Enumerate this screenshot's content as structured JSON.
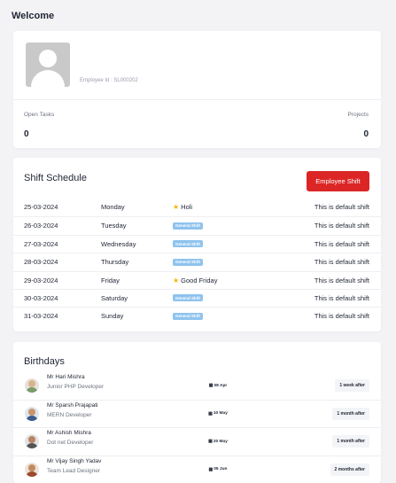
{
  "page": {
    "welcome": "Welcome"
  },
  "profile": {
    "employee_id": "Employee Id : SL000202",
    "open_tasks_label": "Open Tasks",
    "open_tasks_value": "0",
    "projects_label": "Projects",
    "projects_value": "0"
  },
  "shift": {
    "title": "Shift Schedule",
    "button": "Employee Shift",
    "rows": [
      {
        "date": "25-03-2024",
        "day": "Monday",
        "tag": "Holi",
        "tag_type": "holiday",
        "desc": "This is default shift"
      },
      {
        "date": "26-03-2024",
        "day": "Tuesday",
        "tag": "General Shift",
        "tag_type": "badge",
        "desc": "This is default shift"
      },
      {
        "date": "27-03-2024",
        "day": "Wednesday",
        "tag": "General Shift",
        "tag_type": "badge",
        "desc": "This is default shift"
      },
      {
        "date": "28-03-2024",
        "day": "Thursday",
        "tag": "General Shift",
        "tag_type": "badge",
        "desc": "This is default shift"
      },
      {
        "date": "29-03-2024",
        "day": "Friday",
        "tag": "Good Friday",
        "tag_type": "holiday",
        "desc": "This is default shift"
      },
      {
        "date": "30-03-2024",
        "day": "Saturday",
        "tag": "General Shift",
        "tag_type": "badge",
        "desc": "This is default shift"
      },
      {
        "date": "31-03-2024",
        "day": "Sunday",
        "tag": "General Shift",
        "tag_type": "badge",
        "desc": "This is default shift"
      }
    ]
  },
  "birthdays": {
    "title": "Birthdays",
    "items": [
      {
        "name": "Mr Hari Mishra",
        "role": "Junior PHP Developer",
        "date": "08 Apr",
        "after": "1 week after"
      },
      {
        "name": "Mr Sparsh Prajapati",
        "role": "MERN Developer",
        "date": "10 May",
        "after": "1 month after"
      },
      {
        "name": "Mr Ashish Mishra",
        "role": "Dot net Developer",
        "date": "20 May",
        "after": "1 month after"
      },
      {
        "name": "Mr Vijay Singh Yadav",
        "role": "Team Lead Designer",
        "date": "05 Jun",
        "after": "2 months after"
      }
    ]
  },
  "colors": {
    "accent": "#dc2626",
    "badge": "#8ec3ee",
    "star": "#f6b500"
  }
}
